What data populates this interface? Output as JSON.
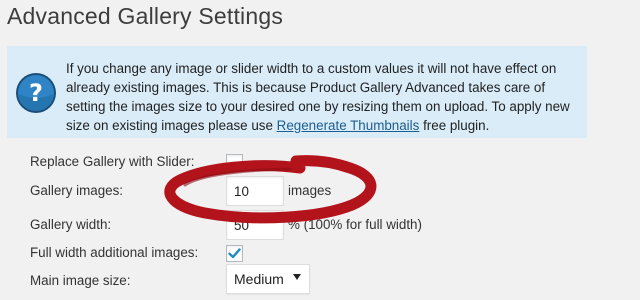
{
  "page": {
    "title": "Advanced Gallery Settings"
  },
  "notice": {
    "icon": "question-help-icon",
    "text_before_link": "If you change any image or slider width to a custom values it will not have effect on already existing images. This is because Product Gallery Advanced takes care of setting the images size to your desired one by resizing them on upload. To apply new size on existing images please use ",
    "link_text": "Regenerate Thumbnails",
    "text_after_link": " free plugin."
  },
  "settings": {
    "replace_gallery": {
      "label": "Replace Gallery with Slider:",
      "checked": false
    },
    "gallery_images": {
      "label": "Gallery images:",
      "value": "10",
      "suffix": "images"
    },
    "gallery_width": {
      "label": "Gallery width:",
      "value": "50",
      "suffix": "% (100% for full width)"
    },
    "full_width_additional": {
      "label": "Full width additional images:",
      "checked": true
    },
    "main_image_size": {
      "label": "Main image size:",
      "selected": "Medium"
    }
  },
  "colors": {
    "notice_bg": "#d9ecf8",
    "link": "#1d5e91",
    "highlight_circle": "#b3141c",
    "checkmark": "#1e8cbe"
  }
}
